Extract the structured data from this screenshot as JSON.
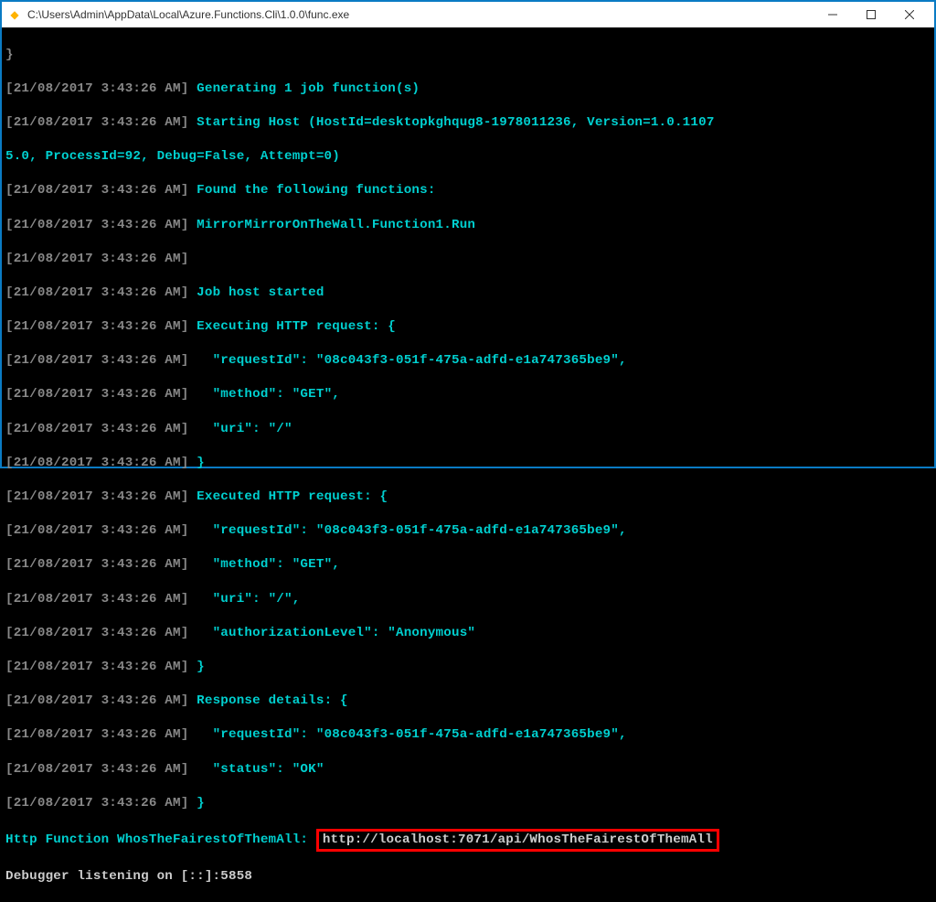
{
  "titlebar": {
    "path": "C:\\Users\\Admin\\AppData\\Local\\Azure.Functions.Cli\\1.0.0\\func.exe"
  },
  "ts": "[21/08/2017 3:43:26 AM] ",
  "lines": {
    "close_brace": "}",
    "gen": "Generating 1 job function(s)",
    "startingHost": "Starting Host (HostId=desktopkghqug8-1978011236, Version=1.0.1107",
    "startingHostCont": "5.0, ProcessId=92, Debug=False, Attempt=0)",
    "found": "Found the following functions:",
    "mirror": "MirrorMirrorOnTheWall.Function1.Run",
    "jobHost": "Job host started",
    "execReq": "Executing HTTP request: {",
    "reqId": "  \"requestId\": \"08c043f3-051f-475a-adfd-e1a747365be9\",",
    "method": "  \"method\": \"GET\",",
    "uri": "  \"uri\": \"/\"",
    "uriComma": "  \"uri\": \"/\",",
    "execd": "Executed HTTP request: {",
    "auth": "  \"authorizationLevel\": \"Anonymous\"",
    "resp": "Response details: {",
    "status": "  \"status\": \"OK\"",
    "httpFn": "Http Function WhosTheFairestOfThemAll: ",
    "url": "http://localhost:7071/api/WhosTheFairestOfThemAll",
    "debugger": "Debugger listening on [::]:5858"
  }
}
